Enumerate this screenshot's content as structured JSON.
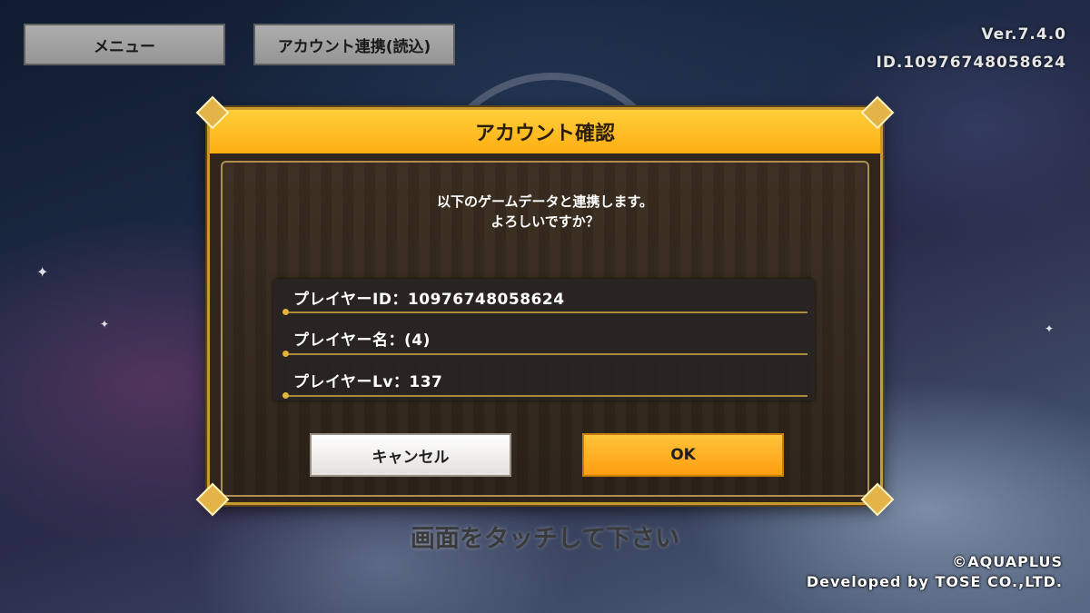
{
  "top_bar": {
    "menu_label": "メニュー",
    "account_link_label": "アカウント連携(読込)",
    "version": "Ver.7.4.0",
    "id": "ID.10976748058624"
  },
  "dialog": {
    "title": "アカウント確認",
    "message_line1": "以下のゲームデータと連携します。",
    "message_line2": "よろしいですか？",
    "player_id": "プレイヤーID：10976748058624",
    "player_name": "プレイヤー名：(4)",
    "player_level": "プレイヤーLv：137",
    "cancel_label": "キャンセル",
    "ok_label": "OK"
  },
  "footer": {
    "touch_prompt": "画面をタッチして下さい",
    "copyright_line1": "©AQUAPLUS",
    "copyright_line2": "Developed by TOSE CO.,LTD."
  },
  "colors": {
    "title_bar": "#ffae12",
    "ok_button": "#ffb020",
    "gold_frame": "#c89a2e"
  }
}
